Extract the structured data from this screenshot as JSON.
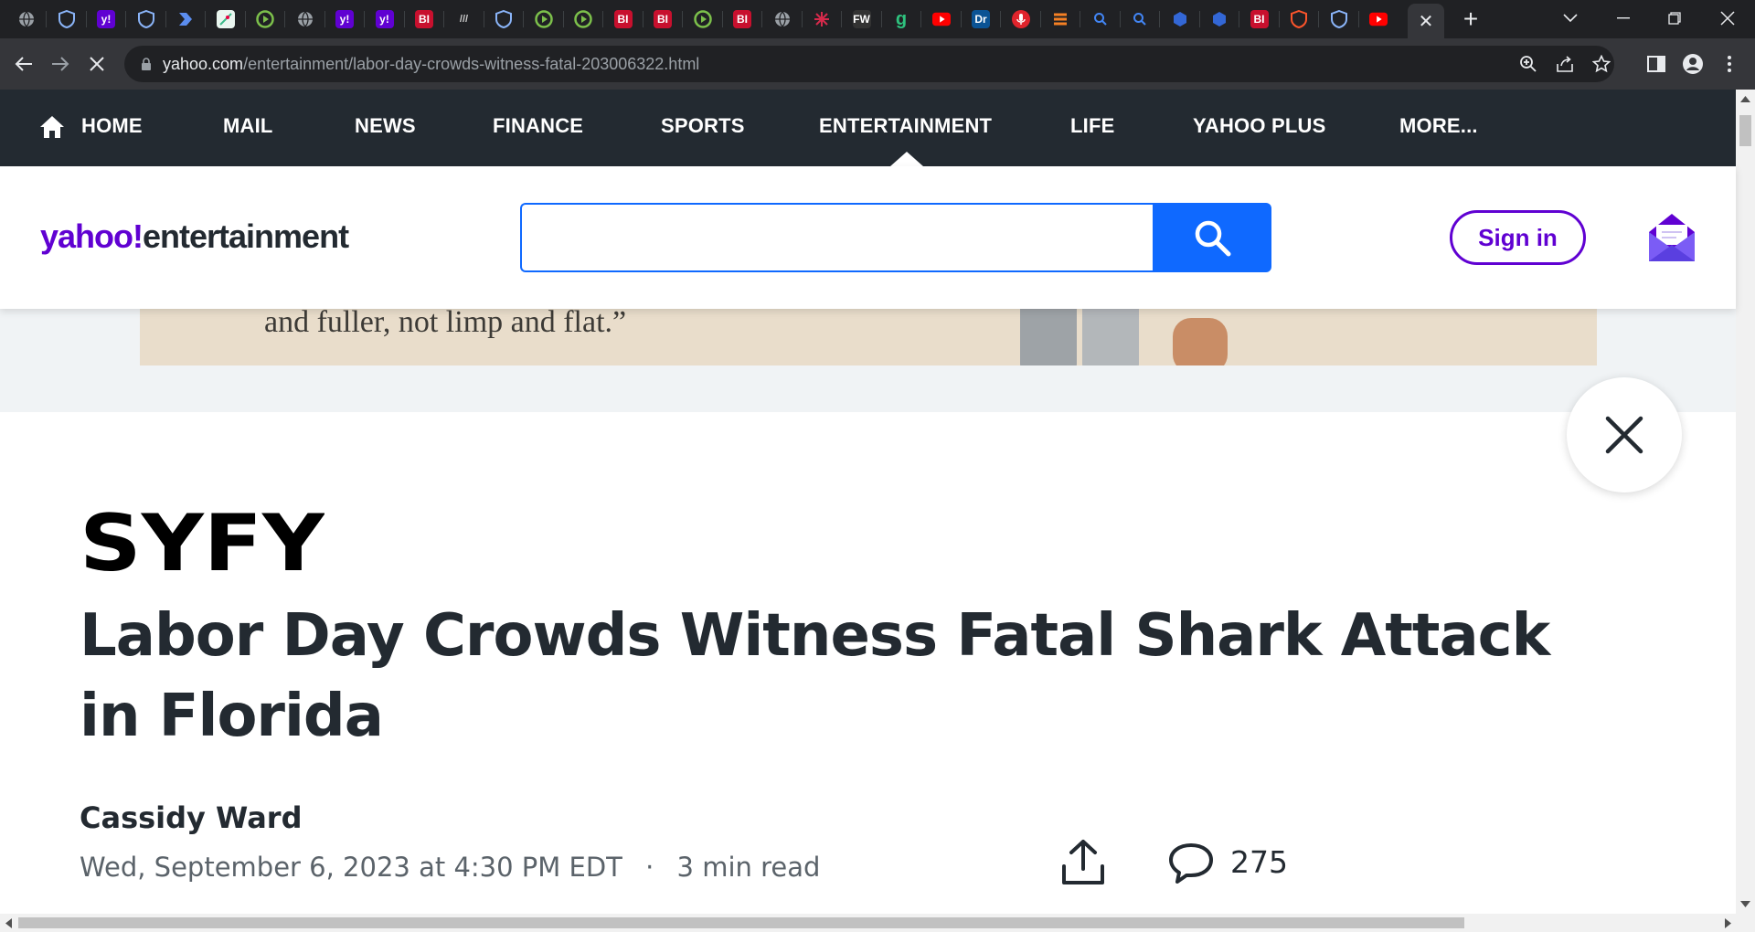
{
  "browser": {
    "url_host": "yahoo.com",
    "url_path": "/entertainment/labor-day-crowds-witness-fatal-203006322.html",
    "tab_close_symbol": "✕",
    "new_tab_symbol": "+",
    "tabs": [
      {
        "icon": "globe-icon",
        "color": "#9aa0a6"
      },
      {
        "icon": "shield-icon",
        "color": "#8ab4f8"
      },
      {
        "icon": "yahoo-icon",
        "color": "#6001d2",
        "text": "y!"
      },
      {
        "icon": "shield-icon",
        "color": "#8ab4f8"
      },
      {
        "icon": "arrow-icon",
        "color": "#5b8def"
      },
      {
        "icon": "map-icon",
        "color": "#3cba8a"
      },
      {
        "icon": "play-icon",
        "color": "#7cc04b"
      },
      {
        "icon": "globe-icon",
        "color": "#9aa0a6"
      },
      {
        "icon": "yahoo-icon",
        "color": "#6001d2",
        "text": "y!"
      },
      {
        "icon": "yahoo-icon",
        "color": "#6001d2",
        "text": "y!"
      },
      {
        "icon": "bi-icon",
        "color": "#c8102e",
        "text": "BI"
      },
      {
        "icon": "slashes-icon",
        "color": "#444",
        "text": "///"
      },
      {
        "icon": "shield-icon",
        "color": "#8ab4f8"
      },
      {
        "icon": "play-icon",
        "color": "#7cc04b"
      },
      {
        "icon": "play-icon",
        "color": "#7cc04b"
      },
      {
        "icon": "bi-icon",
        "color": "#c8102e",
        "text": "BI"
      },
      {
        "icon": "bi-icon",
        "color": "#c8102e",
        "text": "BI"
      },
      {
        "icon": "play-icon",
        "color": "#7cc04b"
      },
      {
        "icon": "bi-icon",
        "color": "#c8102e",
        "text": "BI"
      },
      {
        "icon": "globe-icon",
        "color": "#9aa0a6"
      },
      {
        "icon": "burst-icon",
        "color": "#d62a4b"
      },
      {
        "icon": "sites-icon",
        "color": "#333",
        "text": "FW"
      },
      {
        "icon": "g-icon",
        "color": "#2ec27e",
        "text": "g"
      },
      {
        "icon": "youtube-icon",
        "color": "#ff0000"
      },
      {
        "icon": "dr-icon",
        "color": "#0b5394",
        "text": "Dr"
      },
      {
        "icon": "mic-icon",
        "color": "#e0242c"
      },
      {
        "icon": "stack-icon",
        "color": "#f48024"
      },
      {
        "icon": "search-icon",
        "color": "#4285f4"
      },
      {
        "icon": "search-icon",
        "color": "#4285f4"
      },
      {
        "icon": "cube-icon",
        "color": "#3367d6"
      },
      {
        "icon": "cube-icon",
        "color": "#3367d6"
      },
      {
        "icon": "bi-icon",
        "color": "#c8102e",
        "text": "BI"
      },
      {
        "icon": "brave-shield-icon",
        "color": "#fb542b"
      },
      {
        "icon": "shield-icon",
        "color": "#8ab4f8"
      },
      {
        "icon": "youtube-icon",
        "color": "#ff0000"
      }
    ]
  },
  "nav": {
    "items": [
      {
        "label": "HOME",
        "name": "nav-home"
      },
      {
        "label": "MAIL",
        "name": "nav-mail"
      },
      {
        "label": "NEWS",
        "name": "nav-news"
      },
      {
        "label": "FINANCE",
        "name": "nav-finance"
      },
      {
        "label": "SPORTS",
        "name": "nav-sports"
      },
      {
        "label": "ENTERTAINMENT",
        "name": "nav-entertainment"
      },
      {
        "label": "LIFE",
        "name": "nav-life"
      },
      {
        "label": "YAHOO PLUS",
        "name": "nav-yahoo-plus"
      },
      {
        "label": "MORE...",
        "name": "nav-more"
      }
    ],
    "active": "ENTERTAINMENT"
  },
  "header": {
    "logo_yahoo": "yahoo!",
    "logo_section": "entertainment",
    "search_placeholder": "",
    "sign_in_label": "Sign in"
  },
  "ad": {
    "text": "and fuller, not limp and flat.”"
  },
  "article": {
    "publisher": "SYFY",
    "headline": "Labor Day Crowds Witness Fatal Shark Attack in Florida",
    "author": "Cassidy Ward",
    "date": "Wed, September 6, 2023 at 4:30 PM EDT",
    "separator": "·",
    "read_time": "3 min read",
    "comment_count": "275"
  },
  "colors": {
    "yahoo_purple": "#6001d2",
    "nav_bg": "#232a31",
    "search_blue": "#0f69ff"
  }
}
